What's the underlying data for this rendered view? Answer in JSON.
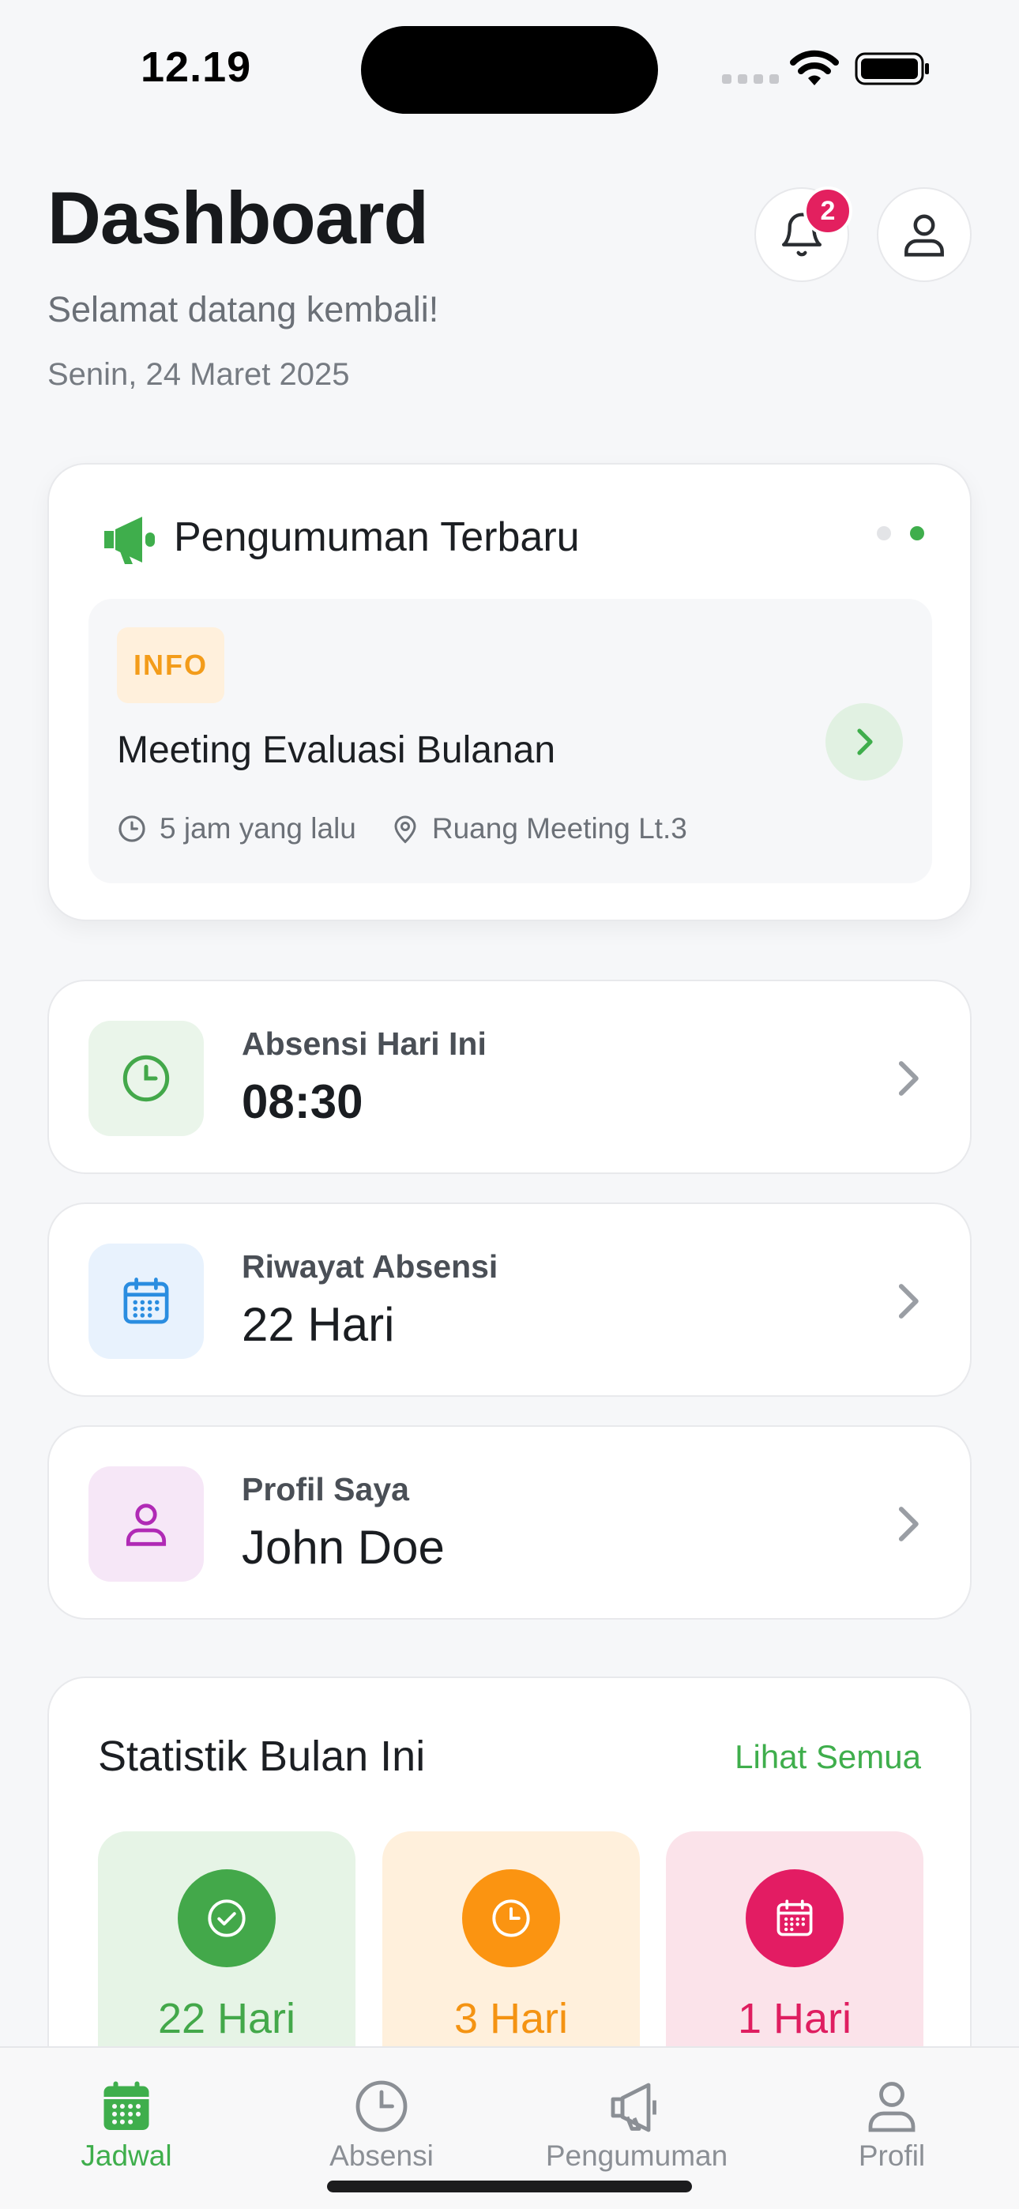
{
  "status_bar": {
    "time": "12.19"
  },
  "header": {
    "title": "Dashboard",
    "subtitle": "Selamat datang kembali!",
    "date": "Senin, 24 Maret 2025",
    "notification_count": "2"
  },
  "announcement": {
    "section_title": "Pengumuman Terbaru",
    "tag": "INFO",
    "heading": "Meeting Evaluasi Bulanan",
    "time_ago": "5 jam yang lalu",
    "location": "Ruang Meeting Lt.3"
  },
  "cards": [
    {
      "label": "Absensi Hari Ini",
      "value": "08:30",
      "icon": "clock-icon",
      "color": "#43a84a"
    },
    {
      "label": "Riwayat Absensi",
      "value": "22 Hari",
      "icon": "calendar-icon",
      "color": "#2a8de0"
    },
    {
      "label": "Profil Saya",
      "value": "John Doe",
      "icon": "user-icon",
      "color": "#b02ab5"
    }
  ],
  "stats": {
    "title": "Statistik Bulan Ini",
    "see_all": "Lihat Semua",
    "items": [
      {
        "value": "22 Hari",
        "icon": "check-circle-icon",
        "color": "#43a84a"
      },
      {
        "value": "3 Hari",
        "icon": "clock-icon",
        "color": "#fb9411"
      },
      {
        "value": "1 Hari",
        "icon": "calendar-icon",
        "color": "#e31c63"
      }
    ]
  },
  "tabs": [
    {
      "label": "Jadwal",
      "icon": "calendar-icon",
      "active": true
    },
    {
      "label": "Absensi",
      "icon": "clock-icon",
      "active": false
    },
    {
      "label": "Pengumuman",
      "icon": "megaphone-icon",
      "active": false
    },
    {
      "label": "Profil",
      "icon": "user-icon",
      "active": false
    }
  ],
  "colors": {
    "accent": "#3fae4c",
    "badge": "#e3205f",
    "background": "#f6f7f9"
  }
}
